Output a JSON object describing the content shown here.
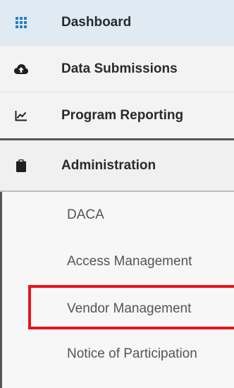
{
  "sidebar": {
    "items": [
      {
        "label": "Dashboard",
        "icon": "grid-icon"
      },
      {
        "label": "Data Submissions",
        "icon": "cloud-upload-icon"
      },
      {
        "label": "Program Reporting",
        "icon": "line-chart-icon"
      },
      {
        "label": "Administration",
        "icon": "clipboard-icon"
      }
    ],
    "submenu": [
      {
        "label": "DACA"
      },
      {
        "label": "Access Management"
      },
      {
        "label": "Vendor Management"
      },
      {
        "label": "Notice of Participation"
      }
    ]
  },
  "colors": {
    "active_background": "#dfeaf3",
    "dashboard_icon": "#2a7fc1",
    "highlight_border": "#e8141c"
  }
}
